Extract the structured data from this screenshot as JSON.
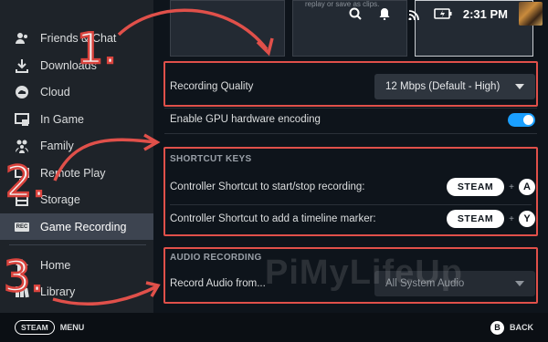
{
  "status": {
    "time": "2:31 PM"
  },
  "sidebar": {
    "items": [
      {
        "label": "Friends & Chat",
        "icon": "friends-icon"
      },
      {
        "label": "Downloads",
        "icon": "download-icon"
      },
      {
        "label": "Cloud",
        "icon": "cloud-icon"
      },
      {
        "label": "In Game",
        "icon": "in-game-icon"
      },
      {
        "label": "Family",
        "icon": "family-icon"
      },
      {
        "label": "Remote Play",
        "icon": "remote-play-icon"
      },
      {
        "label": "Storage",
        "icon": "storage-icon"
      },
      {
        "label": "Game Recording",
        "icon": "rec-icon",
        "badge": "REC",
        "active": true
      },
      {
        "label": "Home",
        "icon": "home-icon"
      },
      {
        "label": "Library",
        "icon": "library-icon"
      }
    ]
  },
  "main": {
    "thumb_caption": "replay or save as clips.",
    "recording_quality": {
      "label": "Recording Quality",
      "value": "12 Mbps (Default - High)"
    },
    "gpu_encoding": {
      "label": "Enable GPU hardware encoding",
      "enabled": true
    },
    "shortcut_keys": {
      "heading": "SHORTCUT KEYS",
      "rows": [
        {
          "label": "Controller Shortcut to start/stop recording:",
          "key1": "STEAM",
          "plus": "+",
          "key2": "A"
        },
        {
          "label": "Controller Shortcut to add a timeline marker:",
          "key1": "STEAM",
          "plus": "+",
          "key2": "Y"
        }
      ]
    },
    "audio_recording": {
      "heading": "AUDIO RECORDING",
      "label": "Record Audio from...",
      "value": "All System Audio"
    }
  },
  "bottom": {
    "steam": "STEAM",
    "menu": "MENU",
    "b": "B",
    "back": "BACK"
  },
  "overlay": {
    "numbers": [
      "1.",
      "2.",
      "3."
    ],
    "watermark": "PiMyLifeUp",
    "accent": "#e0504a"
  }
}
